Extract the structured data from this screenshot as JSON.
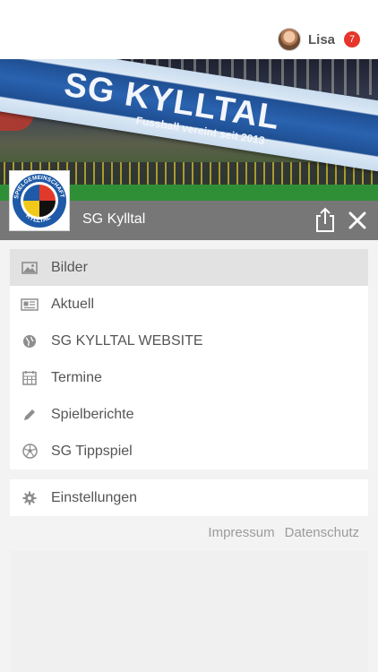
{
  "user": {
    "name": "Lisa",
    "notification_count": "7"
  },
  "banner": {
    "flag_title": "SG KYLLTAL",
    "flag_subtitle": "Fussball vereint seit 2013"
  },
  "club": {
    "name": "SG Kylltal",
    "logo_top_text": "SPIELGEMEINSCHAFT",
    "logo_bottom_text": "KYLLTAL"
  },
  "menu": {
    "items": [
      {
        "label": "Bilder",
        "icon": "image-icon",
        "active": true
      },
      {
        "label": "Aktuell",
        "icon": "newspaper-icon",
        "active": false
      },
      {
        "label": "SG KYLLTAL WEBSITE",
        "icon": "globe-icon",
        "active": false
      },
      {
        "label": "Termine",
        "icon": "calendar-icon",
        "active": false
      },
      {
        "label": "Spielberichte",
        "icon": "pencil-icon",
        "active": false
      },
      {
        "label": "SG Tippspiel",
        "icon": "soccer-ball-icon",
        "active": false
      }
    ],
    "settings_label": "Einstellungen",
    "settings_icon": "gear-icon"
  },
  "footer": {
    "impressum": "Impressum",
    "datenschutz": "Datenschutz"
  },
  "colors": {
    "accent_badge": "#e6352b",
    "club_bar": "#777777",
    "active_item": "#e2e2e2",
    "text": "#555555",
    "link": "#9b9b9b"
  }
}
